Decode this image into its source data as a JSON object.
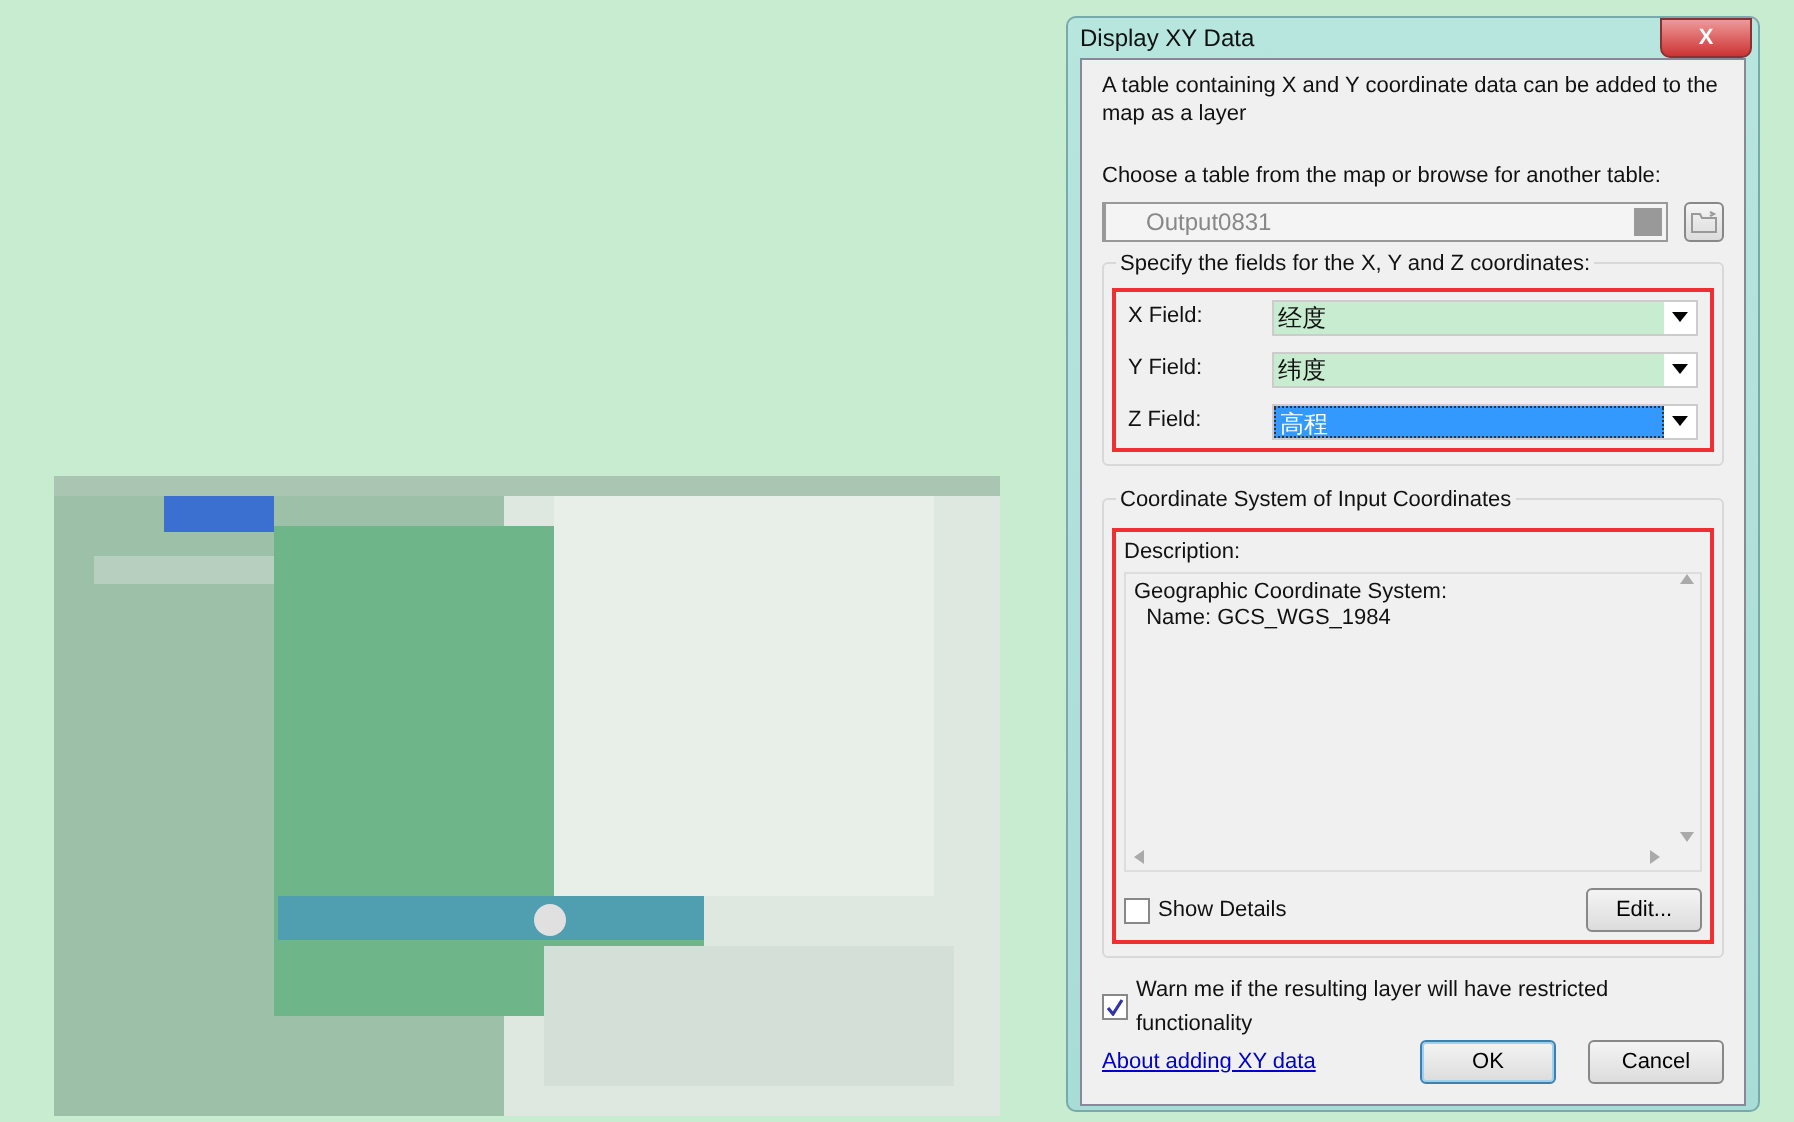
{
  "dialog": {
    "title": "Display XY Data",
    "close_label": "X",
    "intro": "A table containing X and Y coordinate data can be added to the map as a layer",
    "table_prompt": "Choose a table from the map or browse for another table:",
    "table_value": "Output0831",
    "fields_group": {
      "legend": "Specify the fields for the X, Y and Z coordinates:",
      "highlighted": true,
      "fields": [
        {
          "label": "X Field:",
          "value": "经度",
          "selected": false
        },
        {
          "label": "Y Field:",
          "value": "纬度",
          "selected": false
        },
        {
          "label": "Z Field:",
          "value": "高程",
          "selected": true
        }
      ]
    },
    "coord_group": {
      "legend": "Coordinate System of Input Coordinates",
      "highlighted": true,
      "description_label": "Description:",
      "description_lines": [
        "Geographic Coordinate System:",
        "  Name: GCS_WGS_1984"
      ],
      "show_details": {
        "label": "Show Details",
        "checked": false
      },
      "edit_button": "Edit..."
    },
    "warn": {
      "label": "Warn me if the resulting layer will have restricted functionality",
      "checked": true
    },
    "help_link": "About adding XY data",
    "buttons": [
      {
        "label": "OK",
        "default": true
      },
      {
        "label": "Cancel",
        "default": false
      }
    ]
  }
}
